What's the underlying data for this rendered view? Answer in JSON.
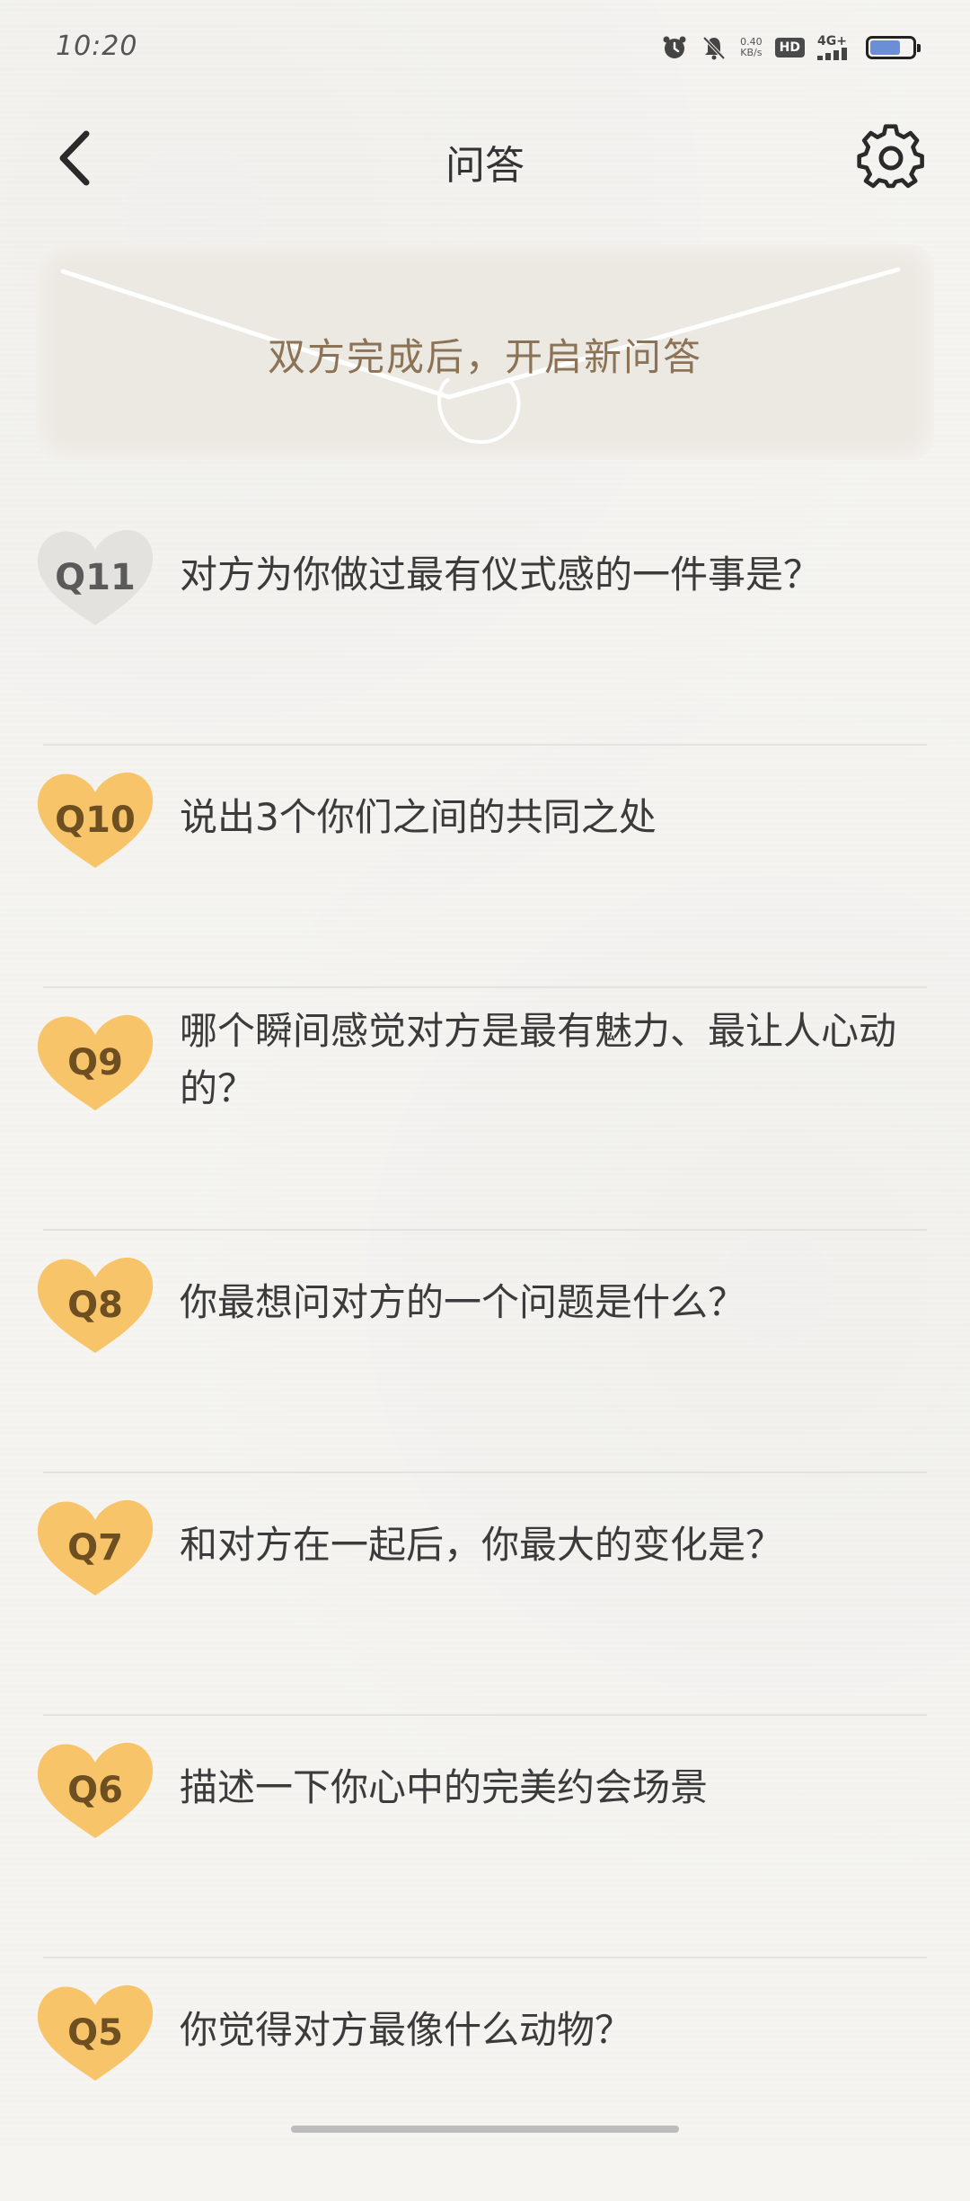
{
  "status_bar": {
    "time": "10:20",
    "speed_value": "0.40",
    "speed_unit": "KB/s",
    "hd": "HD",
    "network": "4G+",
    "battery_level": 0.72
  },
  "header": {
    "title": "问答"
  },
  "banner": {
    "text": "双方完成后，开启新问答"
  },
  "questions": [
    {
      "label": "Q11",
      "text": "对方为你做过最有仪式感的一件事是？",
      "state": "done"
    },
    {
      "label": "Q10",
      "text": "说出3个你们之间的共同之处",
      "state": "active"
    },
    {
      "label": "Q9",
      "text": "哪个瞬间感觉对方是最有魅力、最让人心动的？",
      "state": "active"
    },
    {
      "label": "Q8",
      "text": "你最想问对方的一个问题是什么？",
      "state": "active"
    },
    {
      "label": "Q7",
      "text": "和对方在一起后，你最大的变化是？",
      "state": "active"
    },
    {
      "label": "Q6",
      "text": "描述一下你心中的完美约会场景",
      "state": "active"
    },
    {
      "label": "Q5",
      "text": "你觉得对方最像什么动物？",
      "state": "active"
    }
  ],
  "colors": {
    "badge_active": "#f8c46a",
    "badge_done": "#e4e2de",
    "banner_text": "#8c7355"
  }
}
